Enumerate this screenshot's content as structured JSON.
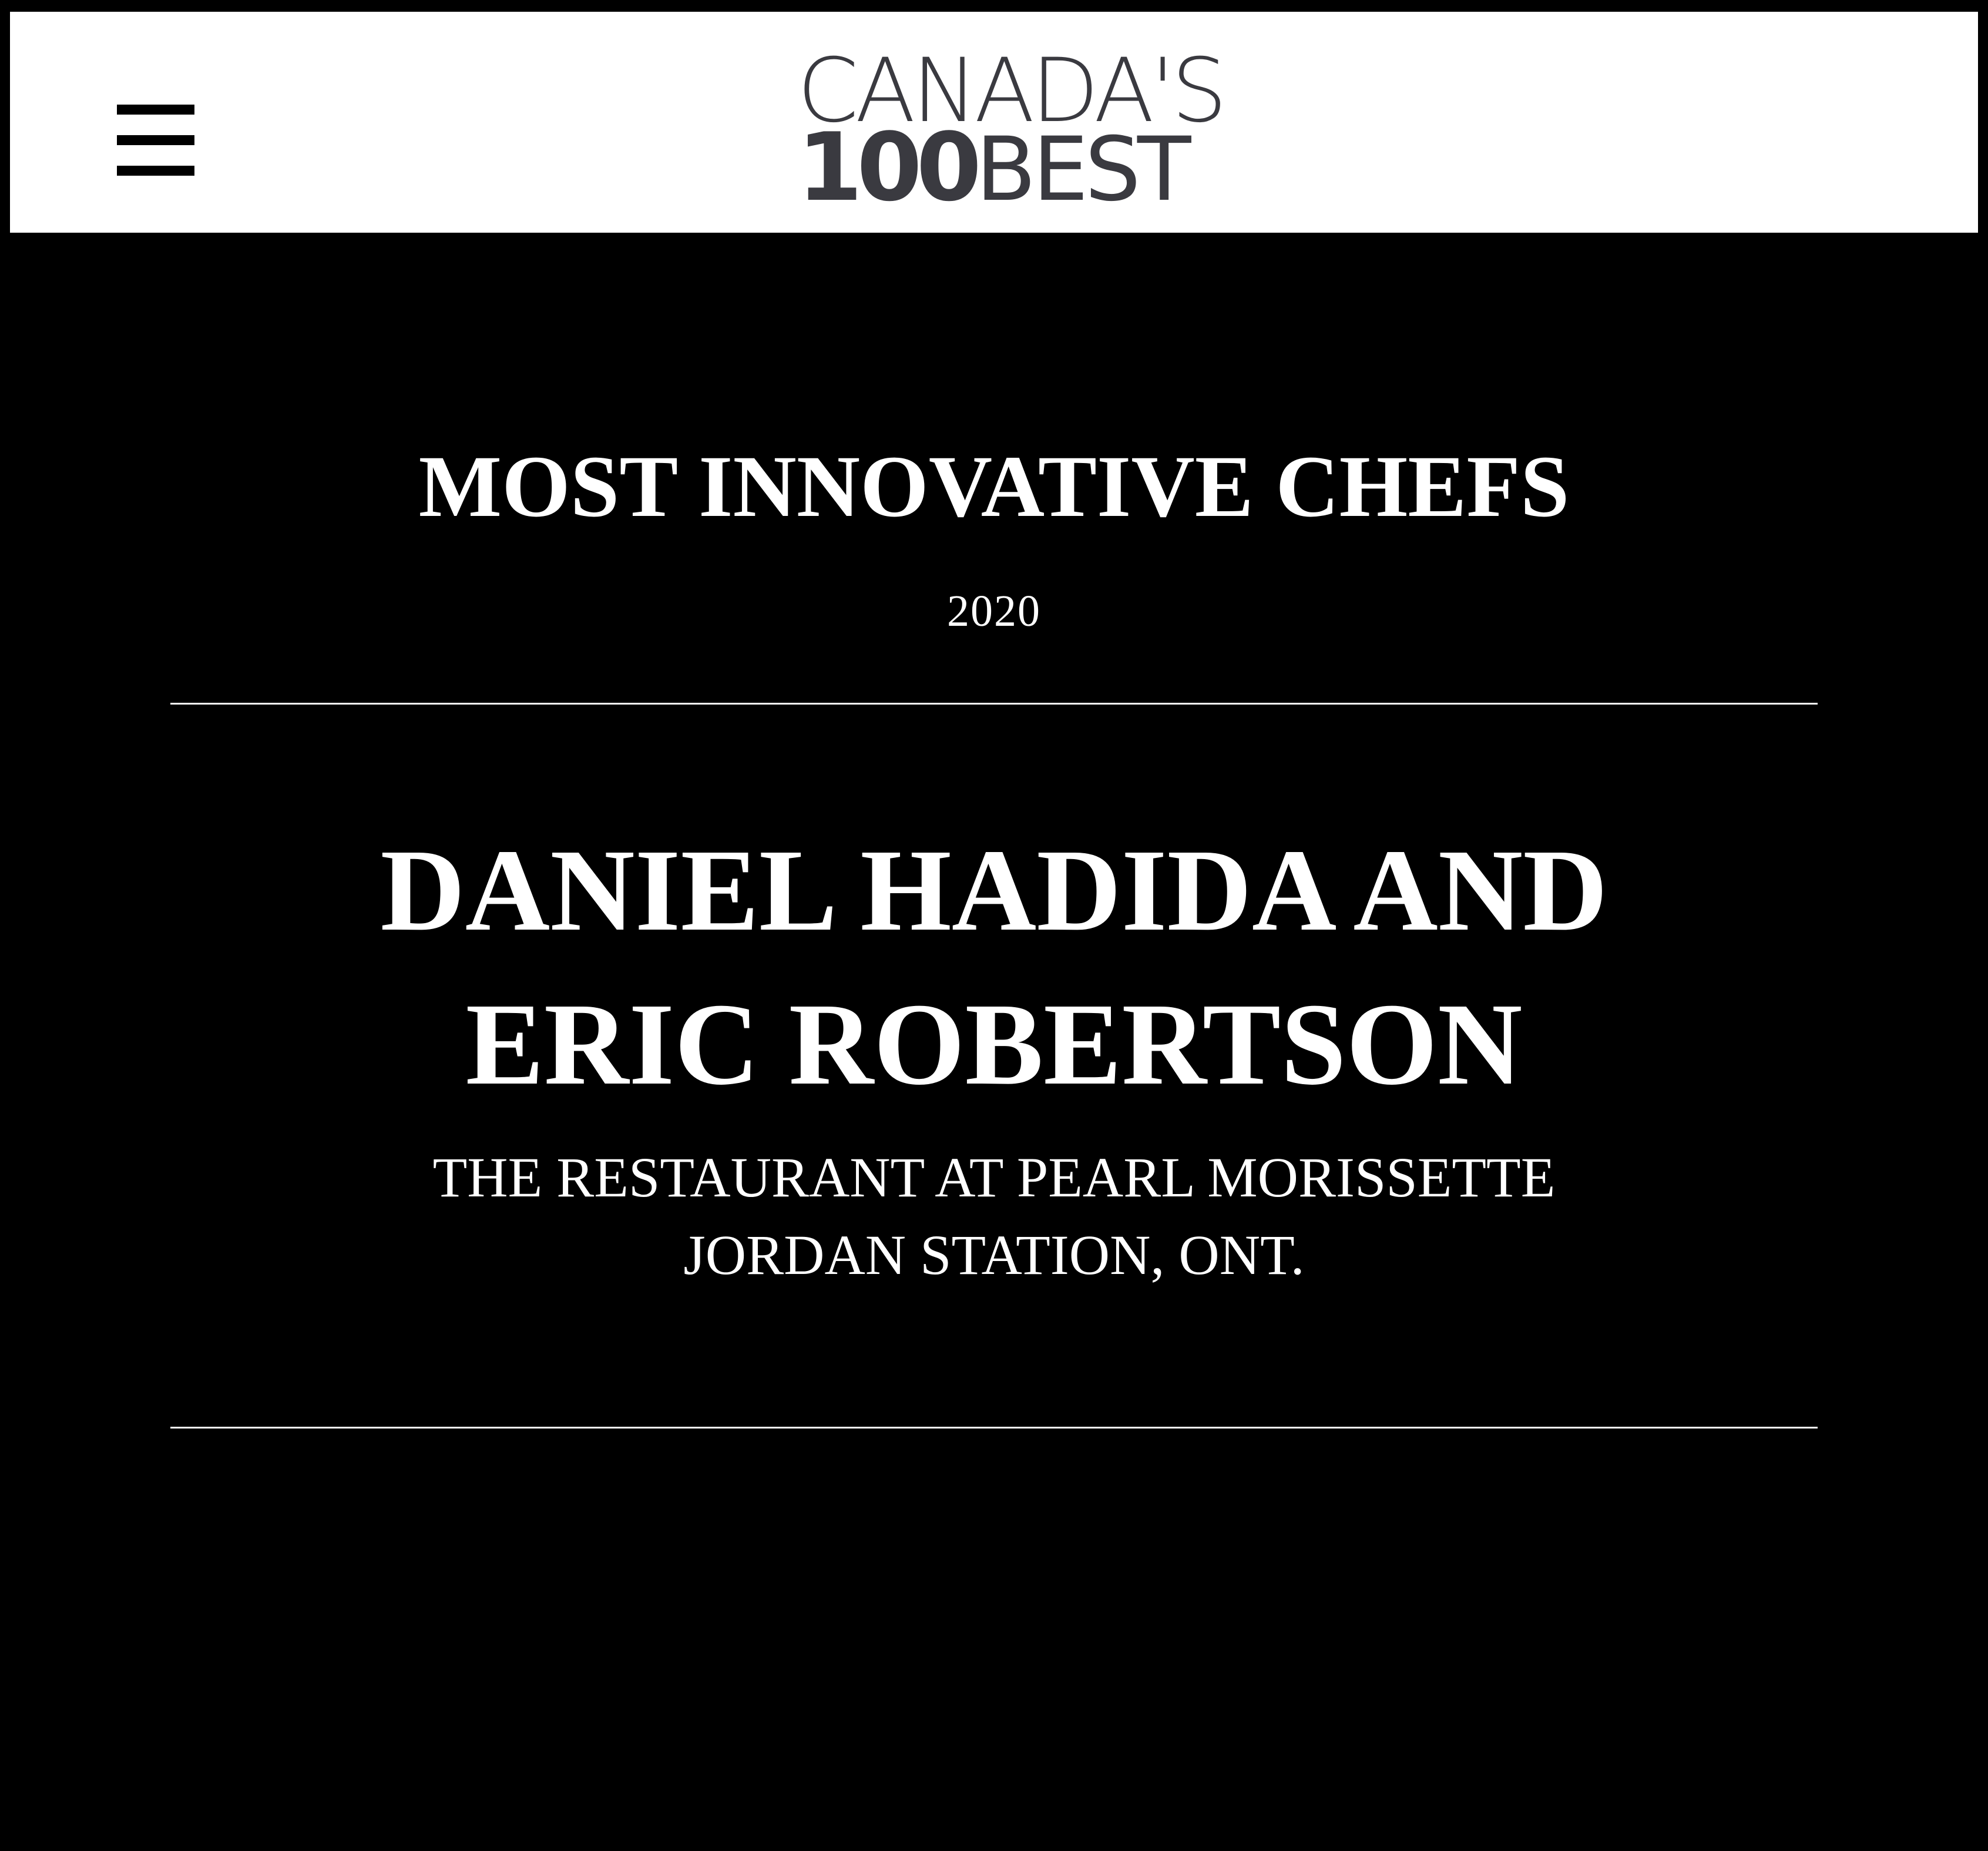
{
  "header": {
    "logo": {
      "line1": "CANADA'S",
      "number": "100",
      "word": "BEST"
    },
    "menu_icon": "hamburger-menu-icon"
  },
  "award": {
    "category": "MOST INNOVATIVE CHEFS",
    "year": "2020"
  },
  "winner": {
    "name_line1": "DANIEL HADIDA AND",
    "name_line2": "ERIC ROBERTSON",
    "restaurant": "THE RESTAURANT AT PEARL MORISSETTE",
    "location": "JORDAN STATION, ONT."
  },
  "colors": {
    "background": "#000000",
    "header_background": "#ffffff",
    "text": "#ffffff",
    "logo_text": "#3a3a40"
  }
}
